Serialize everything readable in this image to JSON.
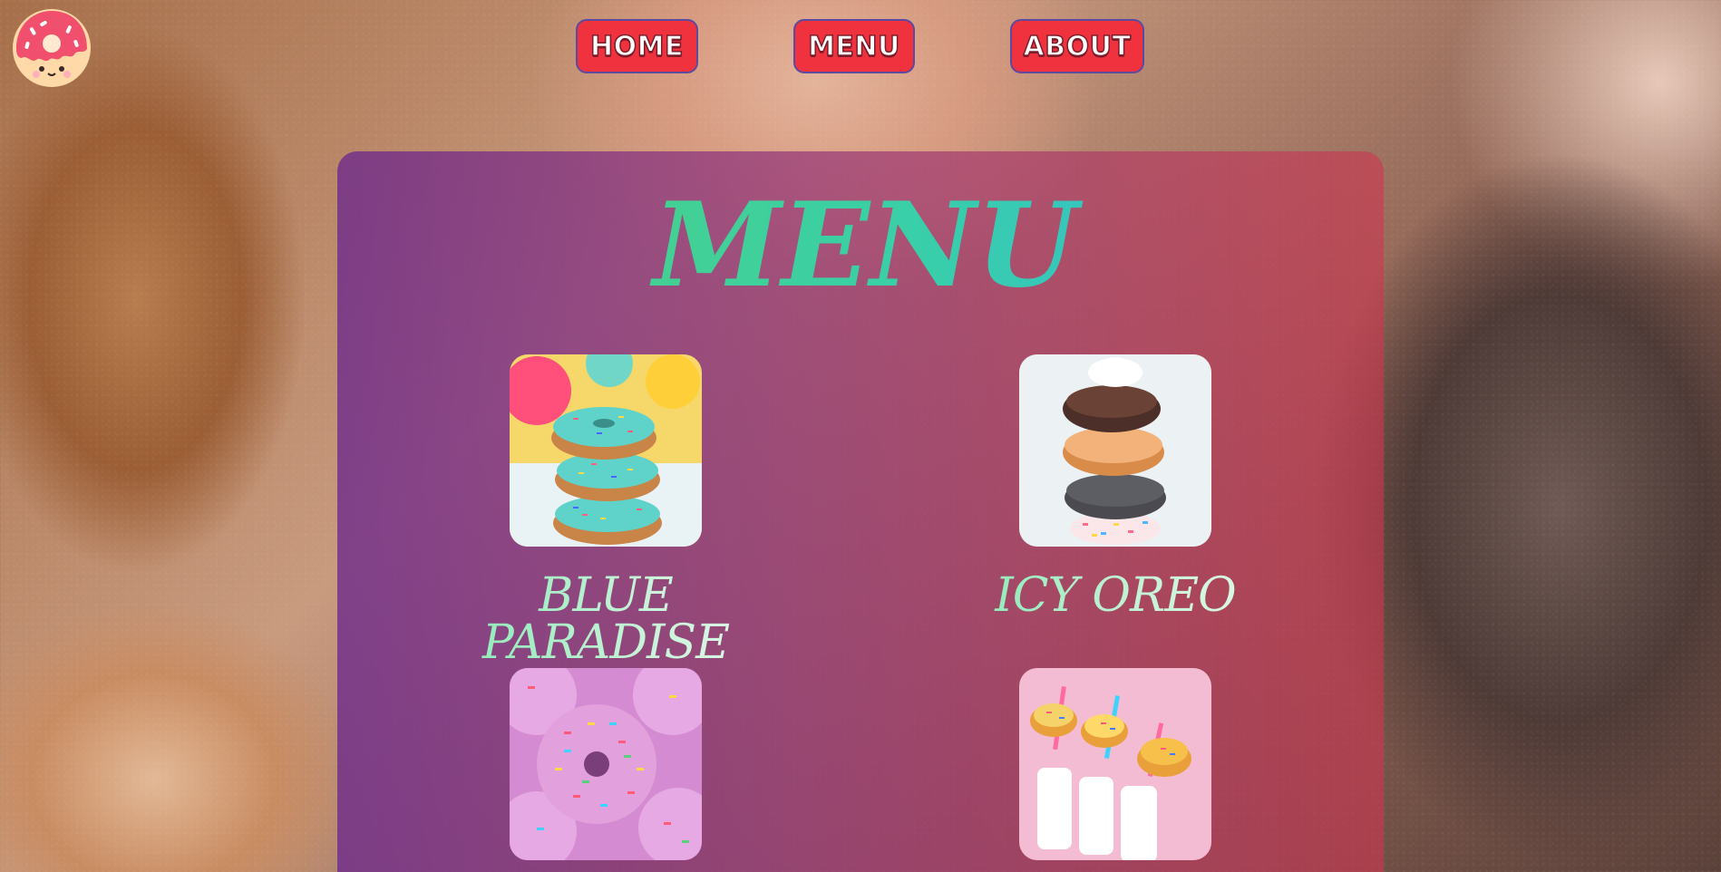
{
  "header": {
    "logo_icon": "donut-logo-icon"
  },
  "nav": {
    "home_label": "HOME",
    "menu_label": "MENU",
    "about_label": "ABOUT"
  },
  "menu": {
    "title": "MENU",
    "items": [
      {
        "name": "BLUE PARADISE",
        "image": "blue-donut-stack-image"
      },
      {
        "name": "ICY OREO",
        "image": "oreo-donut-stack-image"
      },
      {
        "name": "",
        "image": "pink-sprinkle-donuts-image"
      },
      {
        "name": "",
        "image": "donut-milk-bottles-image"
      }
    ]
  },
  "colors": {
    "button_bg": "#f0323f",
    "title_gradient_start": "#4fd17a",
    "title_gradient_end": "#33b6e0",
    "panel_left": "#6c288c",
    "panel_right": "#cd3750"
  }
}
